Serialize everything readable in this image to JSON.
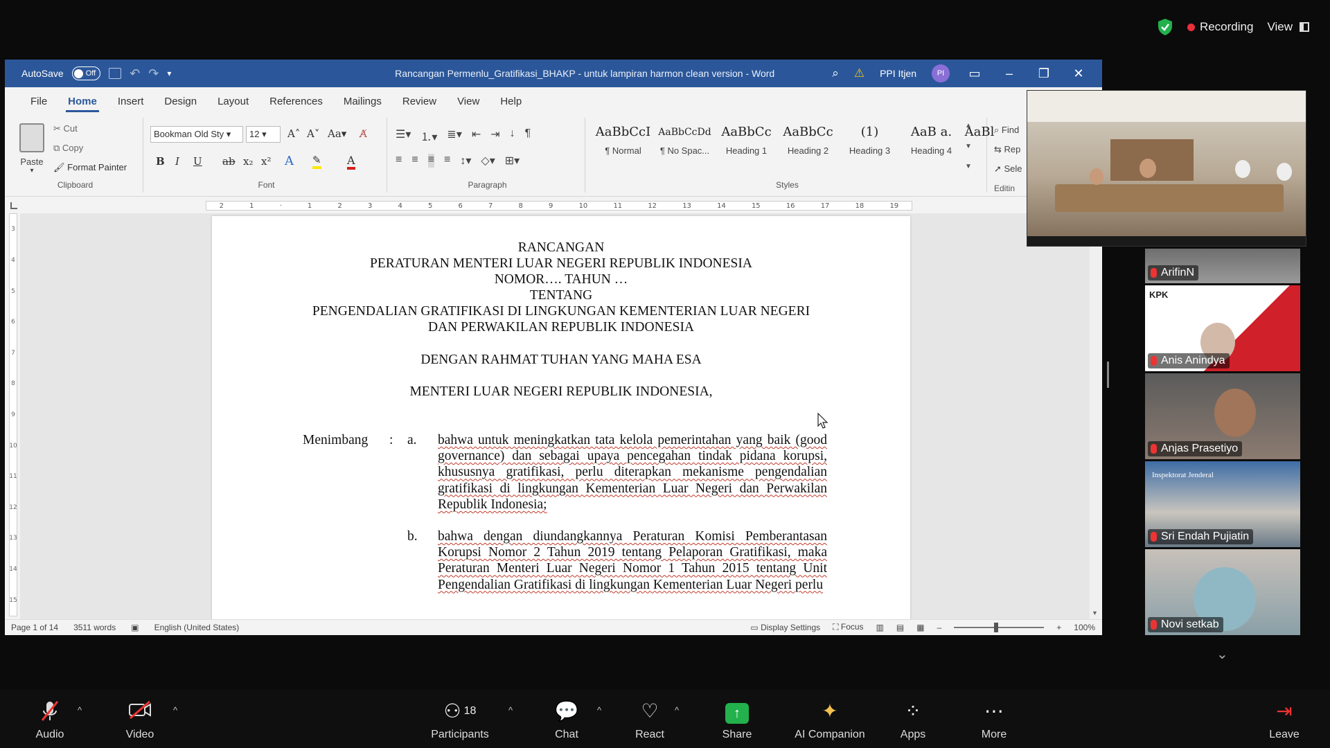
{
  "zoom_top": {
    "recording": "Recording",
    "view": "View"
  },
  "word": {
    "autosave_label": "AutoSave",
    "autosave_state": "Off",
    "title": "Rancangan Permenlu_Gratifikasi_BHAKP - untuk lampiran harmon clean version  -  Word",
    "user_name": "PPI Itjen",
    "user_initials": "PI",
    "tabs": [
      "File",
      "Home",
      "Insert",
      "Design",
      "Layout",
      "References",
      "Mailings",
      "Review",
      "View",
      "Help"
    ],
    "active_tab": "Home",
    "clipboard": {
      "paste": "Paste",
      "cut": "Cut",
      "copy": "Copy",
      "format_painter": "Format Painter",
      "label": "Clipboard"
    },
    "font": {
      "name": "Bookman Old Sty",
      "size": "12",
      "label": "Font"
    },
    "paragraph_label": "Paragraph",
    "styles": [
      {
        "preview": "AaBbCcI",
        "name": "¶ Normal"
      },
      {
        "preview": "AaBbCcDd",
        "name": "¶ No Spac..."
      },
      {
        "preview": "AaBbCc",
        "name": "Heading 1"
      },
      {
        "preview": "AaBbCc",
        "name": "Heading 2"
      },
      {
        "preview": "(1)",
        "name": "Heading 3"
      },
      {
        "preview": "AaB  a.",
        "name": "Heading 4"
      },
      {
        "preview": "AaBl",
        "name": ""
      }
    ],
    "styles_label": "Styles",
    "editing": {
      "find": "Find",
      "replace": "Rep",
      "select": "Sele",
      "label": "Editin"
    },
    "document": {
      "title_lines": [
        "RANCANGAN",
        "PERATURAN MENTERI LUAR NEGERI REPUBLIK INDONESIA",
        "NOMOR…. TAHUN …",
        "TENTANG",
        "PENGENDALIAN GRATIFIKASI DI LINGKUNGAN KEMENTERIAN LUAR NEGERI",
        "DAN PERWAKILAN REPUBLIK INDONESIA"
      ],
      "blessing": "DENGAN RAHMAT TUHAN YANG MAHA ESA",
      "minister": "MENTERI LUAR NEGERI REPUBLIK INDONESIA,",
      "considering_label": "Menimbang",
      "colon": ":",
      "item_a_letter": "a.",
      "item_a": "bahwa untuk meningkatkan tata kelola pemerintahan yang baik (good governance) dan sebagai upaya pencegahan tindak pidana korupsi, khususnya gratifikasi, perlu diterapkan mekanisme pengendalian gratifikasi di lingkungan Kementerian Luar Negeri dan Perwakilan Republik Indonesia;",
      "item_b_letter": "b.",
      "item_b": "bahwa dengan diundangkannya Peraturan Komisi Pemberantasan Korupsi Nomor 2 Tahun 2019 tentang Pelaporan Gratifikasi, maka Peraturan Menteri Luar Negeri Nomor 1 Tahun 2015 tentang Unit Pengendalian Gratifikasi di lingkungan Kementerian Luar Negeri perlu"
    },
    "status": {
      "page": "Page 1 of 14",
      "words": "3511 words",
      "language": "English (United States)",
      "display_settings": "Display Settings",
      "focus": "Focus",
      "zoom": "100%"
    }
  },
  "participants_panel": [
    {
      "name": "ArifinN"
    },
    {
      "name": "Anis Anindya",
      "logo": "KPK"
    },
    {
      "name": "Anjas Prasetiyo"
    },
    {
      "name": "Sri Endah Pujiatin",
      "logo": "Inspektorat Jenderal"
    },
    {
      "name": "Novi setkab"
    }
  ],
  "zoom_toolbar": {
    "audio": "Audio",
    "video": "Video",
    "participants": "Participants",
    "participants_count": "18",
    "chat": "Chat",
    "react": "React",
    "share": "Share",
    "ai_companion": "AI Companion",
    "apps": "Apps",
    "more": "More",
    "leave": "Leave"
  },
  "colors": {
    "word_blue": "#2b579a",
    "share_green": "#22b14c",
    "recording_red": "#e8303a"
  }
}
